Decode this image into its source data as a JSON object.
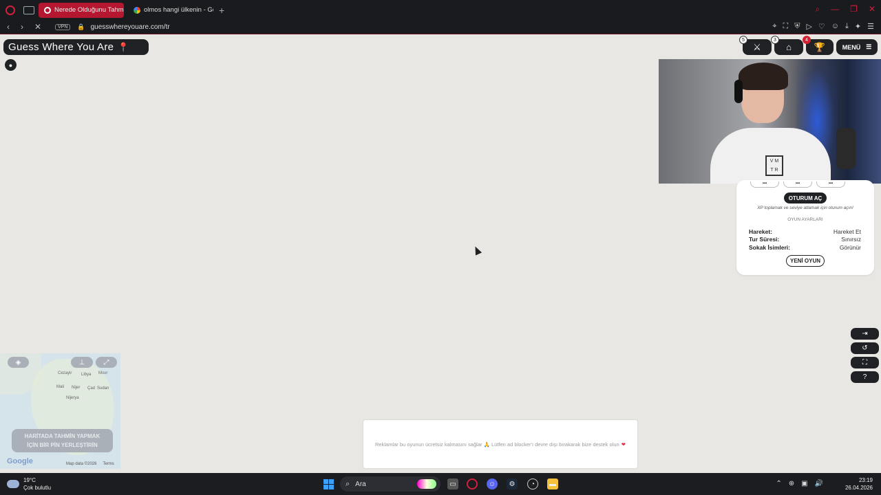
{
  "browser": {
    "tabs": [
      {
        "label": "Nerede Olduğunu Tahmin",
        "active": true
      },
      {
        "label": "olmos hangi ülkenin - Goo",
        "active": false
      }
    ],
    "new_tab": "+",
    "vpn": "VPN",
    "url": "guesswhereyouare.com/tr"
  },
  "header": {
    "brand": "Guess Where You Are",
    "badges": {
      "battle": "5",
      "market": "3",
      "trophy": "4"
    },
    "menu_label": "MENÜ"
  },
  "panel": {
    "login_label": "OTURUM AÇ",
    "xp_note": "XP toplamak ve seviye atlamak için oturum açın!",
    "settings_title": "OYUN AYARLARI",
    "settings": [
      {
        "key": "Hareket:",
        "value": "Hareket Et"
      },
      {
        "key": "Tur Süresi:",
        "value": "Sınırsız"
      },
      {
        "key": "Sokak İsimleri:",
        "value": "Görünür"
      }
    ],
    "new_game_label": "YENİ OYUN"
  },
  "minimap": {
    "guess_line1": "HARİTADA TAHMİN YAPMAK",
    "guess_line2": "İÇİN BİR PİN YERLEŞTİRİN",
    "map_data": "Map data ©2026",
    "terms": "Terms",
    "labels": [
      "Cezayir",
      "Libya",
      "Mısır",
      "Mali",
      "Nijer",
      "Çad",
      "Sudan",
      "Nijerya"
    ]
  },
  "ad_text": "Reklamlar bu oyunun ücretsiz kalmasını sağlar 🙏 Lütfen ad blocker'ı devre dışı bırakarak bize destek olun",
  "taskbar": {
    "temperature": "19°C",
    "weather": "Çok bulutlu",
    "search_label": "Ara",
    "time": "23:19",
    "date": "26.04.2026"
  }
}
